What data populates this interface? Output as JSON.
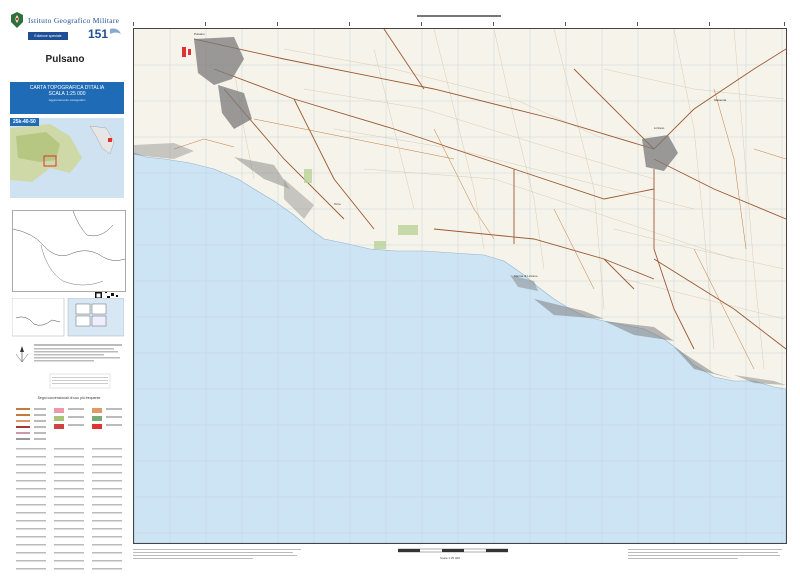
{
  "publisher": {
    "name": "Istituto Geografico Militare",
    "edition": "Edizione speciale"
  },
  "sheet": {
    "name": "Pulsano",
    "series": "CARTA TOPOGRAFICA D'ITALIA",
    "scale": "SCALA 1:25 000",
    "code": "25k-40-50",
    "subtitle": "Aggiornamento cartografico"
  },
  "legend": {
    "title": "Segni convenzionali di uso più frequente"
  },
  "scale_bar": {
    "label": "Scala 1:25 000"
  },
  "colors": {
    "sea": "#cde4f5",
    "land": "#f6f3ea",
    "roads": "#9b5a32",
    "urban": "#6a6a6a",
    "brand": "#1f4e96",
    "title_box": "#1f6bb6"
  },
  "icons": {
    "emblem": "republic-emblem-icon",
    "qr": "qr-code-icon",
    "north": "north-arrow-icon"
  }
}
